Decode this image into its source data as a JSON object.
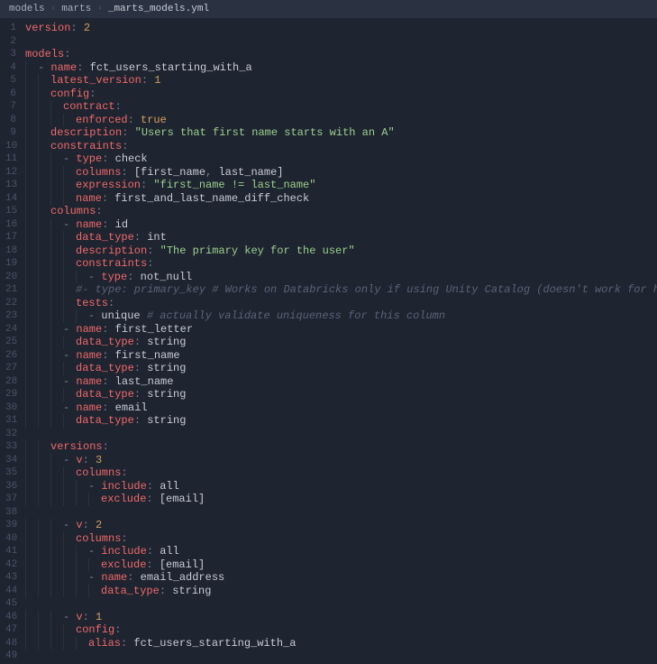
{
  "breadcrumb": {
    "item1": "models",
    "item2": "marts",
    "item3": "_marts_models.yml"
  },
  "lines": [
    {
      "n": 1,
      "tokens": [
        {
          "t": "key",
          "v": "version"
        },
        {
          "t": "colon",
          "v": ": "
        },
        {
          "t": "num",
          "v": "2"
        }
      ],
      "indent": 0
    },
    {
      "n": 2,
      "tokens": [],
      "indent": 0
    },
    {
      "n": 3,
      "tokens": [
        {
          "t": "key",
          "v": "models"
        },
        {
          "t": "colon",
          "v": ":"
        }
      ],
      "indent": 0
    },
    {
      "n": 4,
      "tokens": [
        {
          "t": "dash",
          "v": "- "
        },
        {
          "t": "key",
          "v": "name"
        },
        {
          "t": "colon",
          "v": ": "
        },
        {
          "t": "plain",
          "v": "fct_users_starting_with_a"
        }
      ],
      "indent": 1
    },
    {
      "n": 5,
      "tokens": [
        {
          "t": "key",
          "v": "latest_version"
        },
        {
          "t": "colon",
          "v": ": "
        },
        {
          "t": "num",
          "v": "1"
        }
      ],
      "indent": 2
    },
    {
      "n": 6,
      "tokens": [
        {
          "t": "key",
          "v": "config"
        },
        {
          "t": "colon",
          "v": ":"
        }
      ],
      "indent": 2
    },
    {
      "n": 7,
      "tokens": [
        {
          "t": "key",
          "v": "contract"
        },
        {
          "t": "colon",
          "v": ":"
        }
      ],
      "indent": 3
    },
    {
      "n": 8,
      "tokens": [
        {
          "t": "key",
          "v": "enforced"
        },
        {
          "t": "colon",
          "v": ": "
        },
        {
          "t": "bool",
          "v": "true"
        }
      ],
      "indent": 4
    },
    {
      "n": 9,
      "tokens": [
        {
          "t": "key",
          "v": "description"
        },
        {
          "t": "colon",
          "v": ": "
        },
        {
          "t": "str",
          "v": "\"Users that first name starts with an A\""
        }
      ],
      "indent": 2
    },
    {
      "n": 10,
      "tokens": [
        {
          "t": "key",
          "v": "constraints"
        },
        {
          "t": "colon",
          "v": ":"
        }
      ],
      "indent": 2
    },
    {
      "n": 11,
      "tokens": [
        {
          "t": "dash",
          "v": "- "
        },
        {
          "t": "key",
          "v": "type"
        },
        {
          "t": "colon",
          "v": ": "
        },
        {
          "t": "plain",
          "v": "check"
        }
      ],
      "indent": 3
    },
    {
      "n": 12,
      "tokens": [
        {
          "t": "key",
          "v": "columns"
        },
        {
          "t": "colon",
          "v": ": "
        },
        {
          "t": "bracket",
          "v": "["
        },
        {
          "t": "plain",
          "v": "first_name"
        },
        {
          "t": "colon",
          "v": ", "
        },
        {
          "t": "plain",
          "v": "last_name"
        },
        {
          "t": "bracket",
          "v": "]"
        }
      ],
      "indent": 4
    },
    {
      "n": 13,
      "tokens": [
        {
          "t": "key",
          "v": "expression"
        },
        {
          "t": "colon",
          "v": ": "
        },
        {
          "t": "str",
          "v": "\"first_name != last_name\""
        }
      ],
      "indent": 4
    },
    {
      "n": 14,
      "tokens": [
        {
          "t": "key",
          "v": "name"
        },
        {
          "t": "colon",
          "v": ": "
        },
        {
          "t": "plain",
          "v": "first_and_last_name_diff_check"
        }
      ],
      "indent": 4
    },
    {
      "n": 15,
      "tokens": [
        {
          "t": "key",
          "v": "columns"
        },
        {
          "t": "colon",
          "v": ":"
        }
      ],
      "indent": 2
    },
    {
      "n": 16,
      "tokens": [
        {
          "t": "dash",
          "v": "- "
        },
        {
          "t": "key",
          "v": "name"
        },
        {
          "t": "colon",
          "v": ": "
        },
        {
          "t": "plain",
          "v": "id"
        }
      ],
      "indent": 3
    },
    {
      "n": 17,
      "tokens": [
        {
          "t": "key",
          "v": "data_type"
        },
        {
          "t": "colon",
          "v": ": "
        },
        {
          "t": "plain",
          "v": "int"
        }
      ],
      "indent": 4
    },
    {
      "n": 18,
      "tokens": [
        {
          "t": "key",
          "v": "description"
        },
        {
          "t": "colon",
          "v": ": "
        },
        {
          "t": "str",
          "v": "\"The primary key for the user\""
        }
      ],
      "indent": 4
    },
    {
      "n": 19,
      "tokens": [
        {
          "t": "key",
          "v": "constraints"
        },
        {
          "t": "colon",
          "v": ":"
        }
      ],
      "indent": 4
    },
    {
      "n": 20,
      "tokens": [
        {
          "t": "dash",
          "v": "- "
        },
        {
          "t": "key",
          "v": "type"
        },
        {
          "t": "colon",
          "v": ": "
        },
        {
          "t": "plain",
          "v": "not_null"
        }
      ],
      "indent": 5
    },
    {
      "n": 21,
      "tokens": [
        {
          "t": "comment",
          "v": "#- type: primary_key # Works on Databricks only if using Unity Catalog (doesn't work for hive_metastore)"
        }
      ],
      "indent": 4
    },
    {
      "n": 22,
      "tokens": [
        {
          "t": "key",
          "v": "tests"
        },
        {
          "t": "colon",
          "v": ":"
        }
      ],
      "indent": 4
    },
    {
      "n": 23,
      "tokens": [
        {
          "t": "dash",
          "v": "- "
        },
        {
          "t": "plain",
          "v": "unique "
        },
        {
          "t": "comment",
          "v": "# actually validate uniqueness for this column"
        }
      ],
      "indent": 5
    },
    {
      "n": 24,
      "tokens": [
        {
          "t": "dash",
          "v": "- "
        },
        {
          "t": "key",
          "v": "name"
        },
        {
          "t": "colon",
          "v": ": "
        },
        {
          "t": "plain",
          "v": "first_letter"
        }
      ],
      "indent": 3
    },
    {
      "n": 25,
      "tokens": [
        {
          "t": "key",
          "v": "data_type"
        },
        {
          "t": "colon",
          "v": ": "
        },
        {
          "t": "plain",
          "v": "string"
        }
      ],
      "indent": 4
    },
    {
      "n": 26,
      "tokens": [
        {
          "t": "dash",
          "v": "- "
        },
        {
          "t": "key",
          "v": "name"
        },
        {
          "t": "colon",
          "v": ": "
        },
        {
          "t": "plain",
          "v": "first_name"
        }
      ],
      "indent": 3
    },
    {
      "n": 27,
      "tokens": [
        {
          "t": "key",
          "v": "data_type"
        },
        {
          "t": "colon",
          "v": ": "
        },
        {
          "t": "plain",
          "v": "string"
        }
      ],
      "indent": 4
    },
    {
      "n": 28,
      "tokens": [
        {
          "t": "dash",
          "v": "- "
        },
        {
          "t": "key",
          "v": "name"
        },
        {
          "t": "colon",
          "v": ": "
        },
        {
          "t": "plain",
          "v": "last_name"
        }
      ],
      "indent": 3
    },
    {
      "n": 29,
      "tokens": [
        {
          "t": "key",
          "v": "data_type"
        },
        {
          "t": "colon",
          "v": ": "
        },
        {
          "t": "plain",
          "v": "string"
        }
      ],
      "indent": 4
    },
    {
      "n": 30,
      "tokens": [
        {
          "t": "dash",
          "v": "- "
        },
        {
          "t": "key",
          "v": "name"
        },
        {
          "t": "colon",
          "v": ": "
        },
        {
          "t": "plain",
          "v": "email"
        }
      ],
      "indent": 3
    },
    {
      "n": 31,
      "tokens": [
        {
          "t": "key",
          "v": "data_type"
        },
        {
          "t": "colon",
          "v": ": "
        },
        {
          "t": "plain",
          "v": "string"
        }
      ],
      "indent": 4
    },
    {
      "n": 32,
      "tokens": [],
      "indent": 0
    },
    {
      "n": 33,
      "tokens": [
        {
          "t": "key",
          "v": "versions"
        },
        {
          "t": "colon",
          "v": ":"
        }
      ],
      "indent": 2
    },
    {
      "n": 34,
      "tokens": [
        {
          "t": "dash",
          "v": "- "
        },
        {
          "t": "key",
          "v": "v"
        },
        {
          "t": "colon",
          "v": ": "
        },
        {
          "t": "num",
          "v": "3"
        }
      ],
      "indent": 3
    },
    {
      "n": 35,
      "tokens": [
        {
          "t": "key",
          "v": "columns"
        },
        {
          "t": "colon",
          "v": ":"
        }
      ],
      "indent": 4
    },
    {
      "n": 36,
      "tokens": [
        {
          "t": "dash",
          "v": "- "
        },
        {
          "t": "key",
          "v": "include"
        },
        {
          "t": "colon",
          "v": ": "
        },
        {
          "t": "plain",
          "v": "all"
        }
      ],
      "indent": 5
    },
    {
      "n": 37,
      "tokens": [
        {
          "t": "key",
          "v": "exclude"
        },
        {
          "t": "colon",
          "v": ": "
        },
        {
          "t": "bracket",
          "v": "["
        },
        {
          "t": "plain",
          "v": "email"
        },
        {
          "t": "bracket",
          "v": "]"
        }
      ],
      "indent": 6
    },
    {
      "n": 38,
      "tokens": [],
      "indent": 0
    },
    {
      "n": 39,
      "tokens": [
        {
          "t": "dash",
          "v": "- "
        },
        {
          "t": "key",
          "v": "v"
        },
        {
          "t": "colon",
          "v": ": "
        },
        {
          "t": "num",
          "v": "2"
        }
      ],
      "indent": 3
    },
    {
      "n": 40,
      "tokens": [
        {
          "t": "key",
          "v": "columns"
        },
        {
          "t": "colon",
          "v": ":"
        }
      ],
      "indent": 4
    },
    {
      "n": 41,
      "tokens": [
        {
          "t": "dash",
          "v": "- "
        },
        {
          "t": "key",
          "v": "include"
        },
        {
          "t": "colon",
          "v": ": "
        },
        {
          "t": "plain",
          "v": "all"
        }
      ],
      "indent": 5
    },
    {
      "n": 42,
      "tokens": [
        {
          "t": "key",
          "v": "exclude"
        },
        {
          "t": "colon",
          "v": ": "
        },
        {
          "t": "bracket",
          "v": "["
        },
        {
          "t": "plain",
          "v": "email"
        },
        {
          "t": "bracket",
          "v": "]"
        }
      ],
      "indent": 6
    },
    {
      "n": 43,
      "tokens": [
        {
          "t": "dash",
          "v": "- "
        },
        {
          "t": "key",
          "v": "name"
        },
        {
          "t": "colon",
          "v": ": "
        },
        {
          "t": "plain",
          "v": "email_address"
        }
      ],
      "indent": 5
    },
    {
      "n": 44,
      "tokens": [
        {
          "t": "key",
          "v": "data_type"
        },
        {
          "t": "colon",
          "v": ": "
        },
        {
          "t": "plain",
          "v": "string"
        }
      ],
      "indent": 6
    },
    {
      "n": 45,
      "tokens": [],
      "indent": 0
    },
    {
      "n": 46,
      "tokens": [
        {
          "t": "dash",
          "v": "- "
        },
        {
          "t": "key",
          "v": "v"
        },
        {
          "t": "colon",
          "v": ": "
        },
        {
          "t": "num",
          "v": "1"
        }
      ],
      "indent": 3
    },
    {
      "n": 47,
      "tokens": [
        {
          "t": "key",
          "v": "config"
        },
        {
          "t": "colon",
          "v": ":"
        }
      ],
      "indent": 4
    },
    {
      "n": 48,
      "tokens": [
        {
          "t": "key",
          "v": "alias"
        },
        {
          "t": "colon",
          "v": ": "
        },
        {
          "t": "plain",
          "v": "fct_users_starting_with_a"
        }
      ],
      "indent": 5
    },
    {
      "n": 49,
      "tokens": [],
      "indent": 0
    }
  ]
}
